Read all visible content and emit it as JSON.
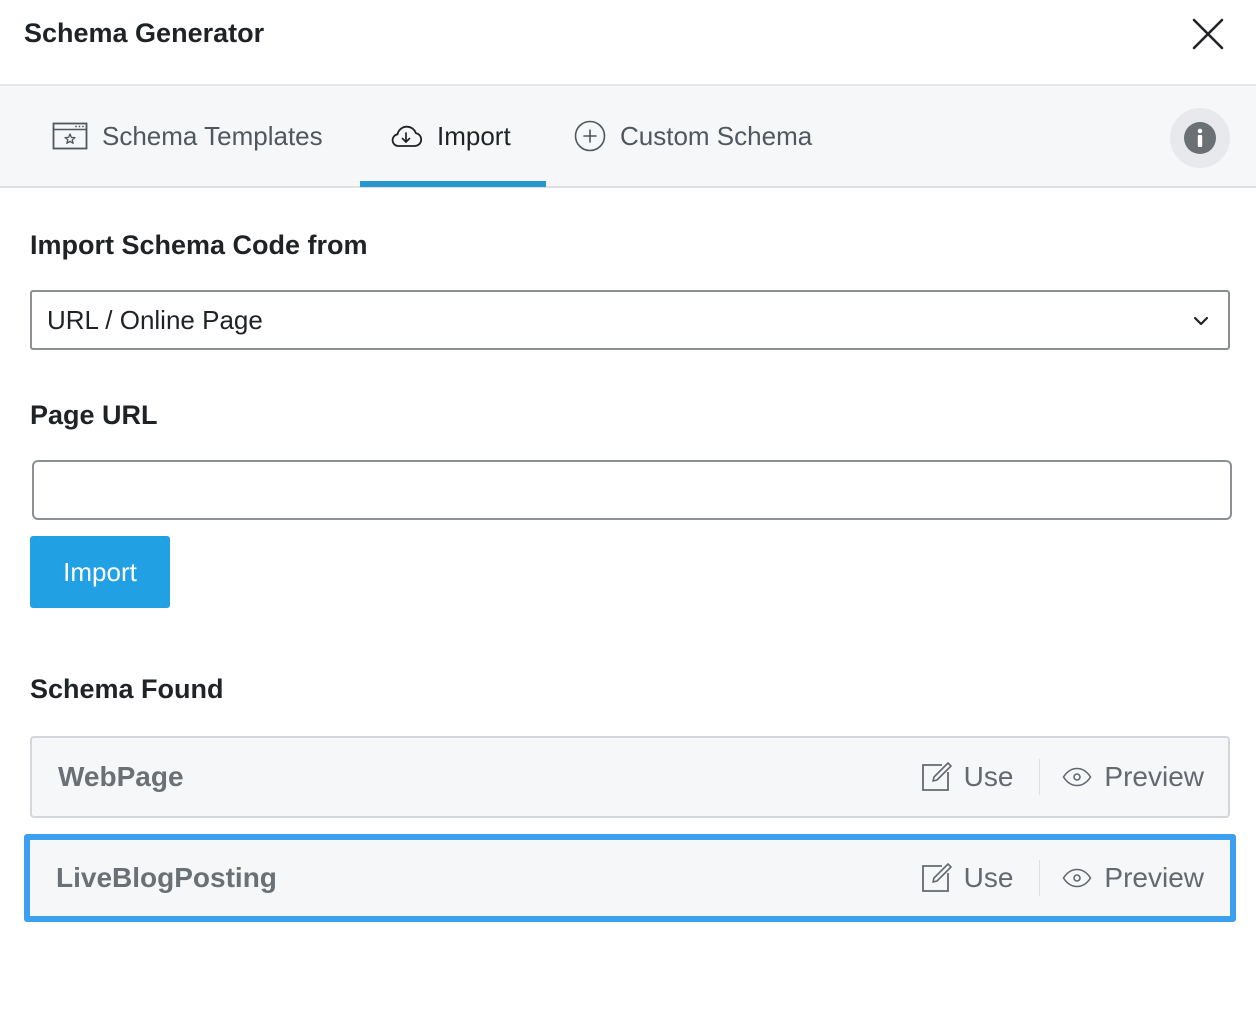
{
  "dialog": {
    "title": "Schema Generator"
  },
  "tabs": [
    {
      "label": "Schema Templates",
      "icon": "browser-star-icon",
      "active": false
    },
    {
      "label": "Import",
      "icon": "cloud-download-icon",
      "active": true
    },
    {
      "label": "Custom Schema",
      "icon": "plus-circle-icon",
      "active": false
    }
  ],
  "import_from": {
    "label": "Import Schema Code from",
    "selected": "URL / Online Page"
  },
  "page_url": {
    "label": "Page URL",
    "value": "",
    "placeholder": ""
  },
  "import_button": {
    "label": "Import"
  },
  "schema_found": {
    "label": "Schema Found",
    "items": [
      {
        "name": "WebPage",
        "use_label": "Use",
        "preview_label": "Preview",
        "selected": false
      },
      {
        "name": "LiveBlogPosting",
        "use_label": "Use",
        "preview_label": "Preview",
        "selected": true
      }
    ]
  },
  "colors": {
    "accent": "#2897cf",
    "button": "#22a0e4",
    "focus": "#3d9ff0"
  }
}
